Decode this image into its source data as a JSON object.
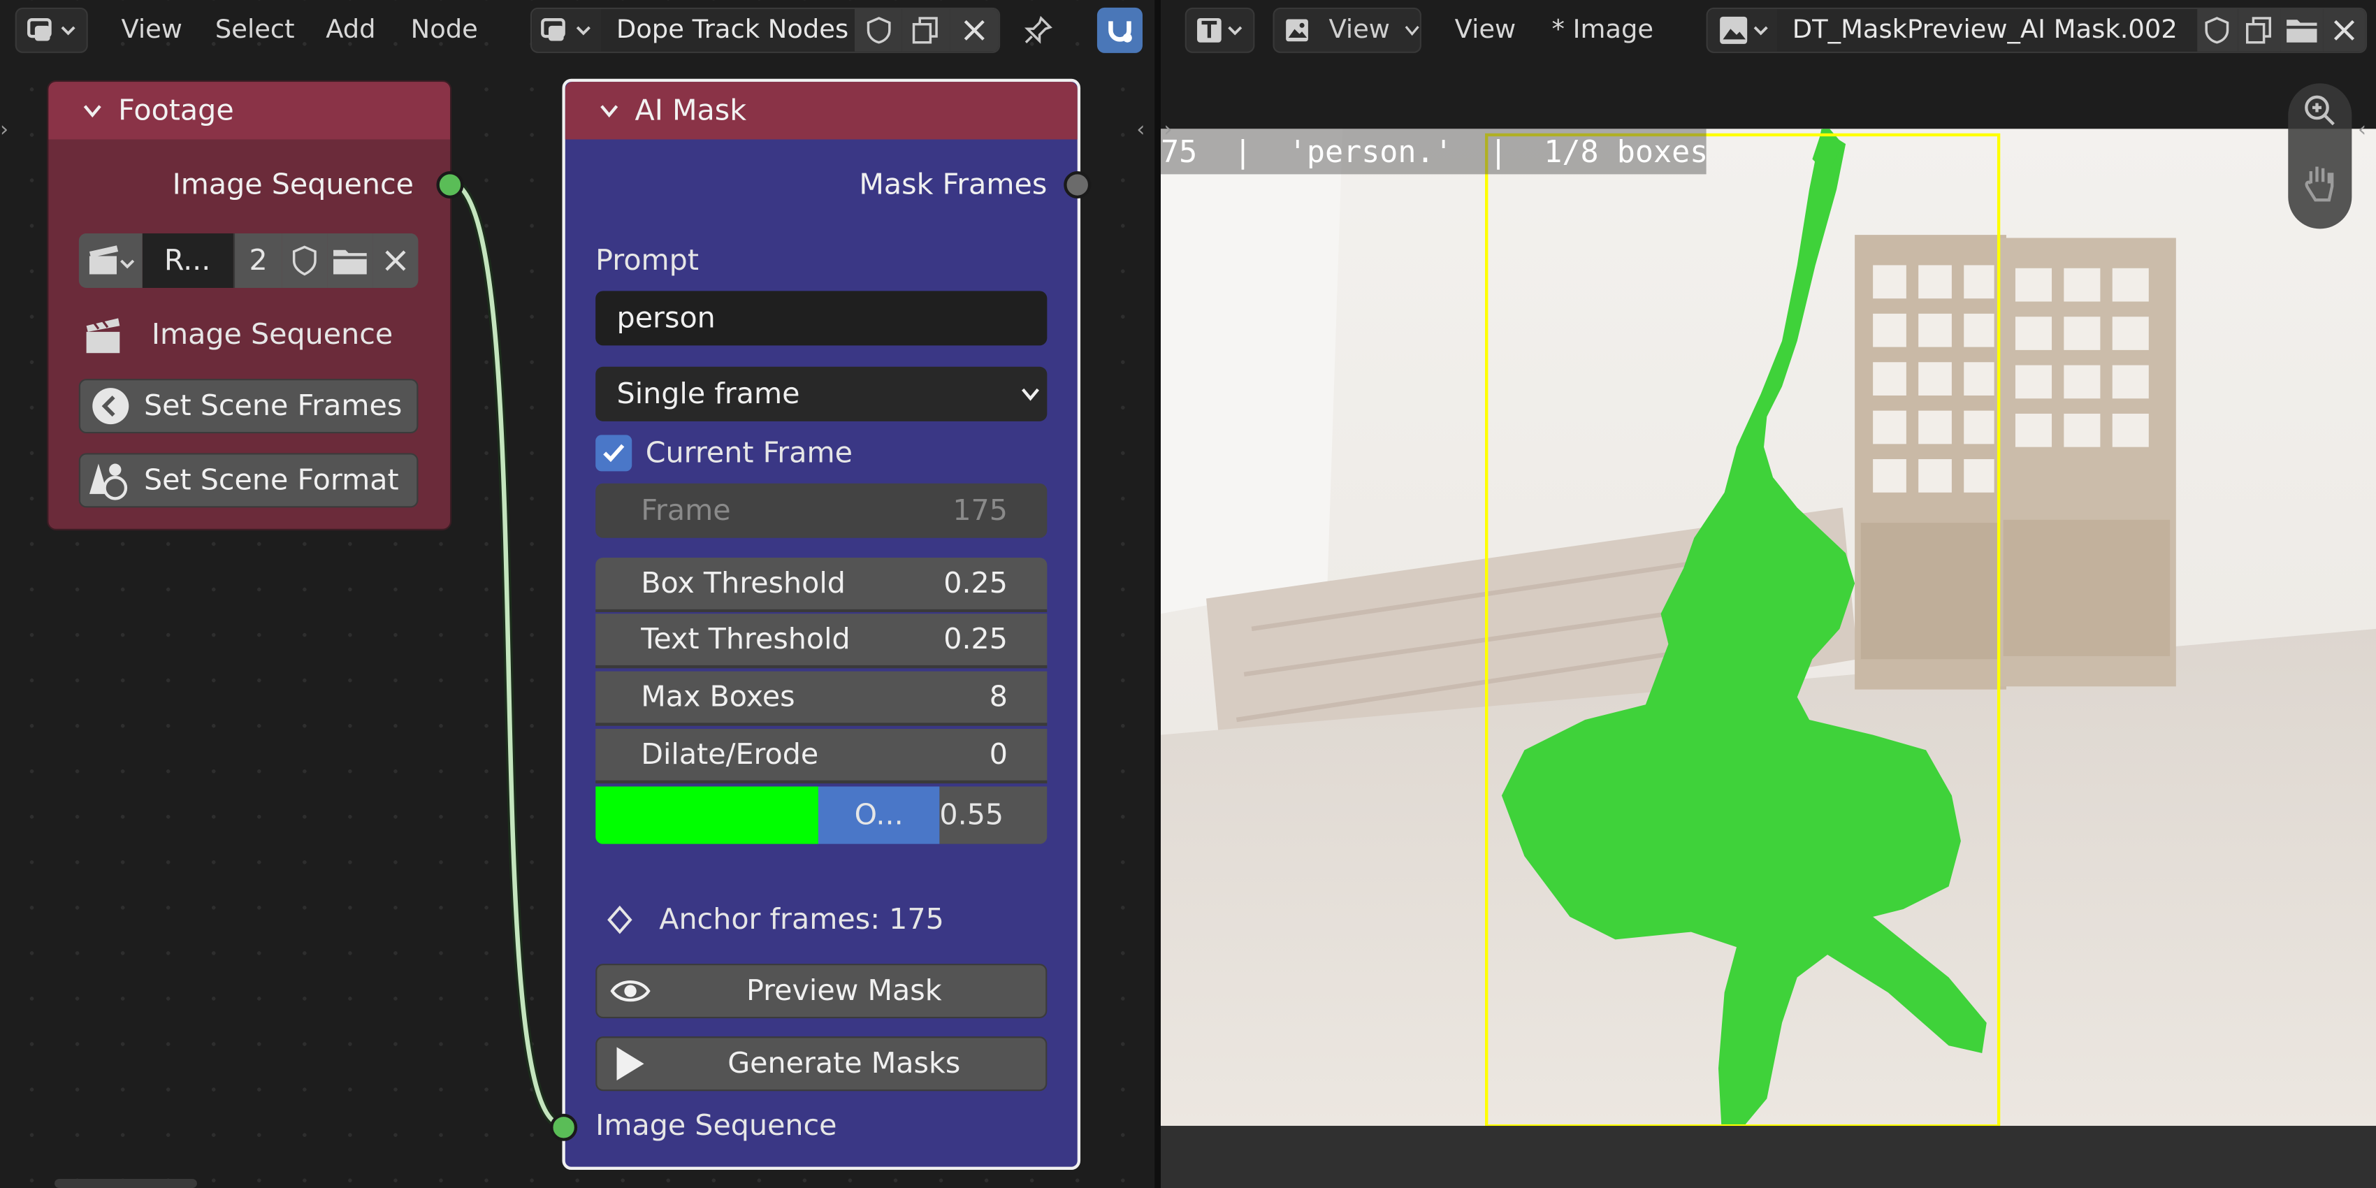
{
  "node_editor": {
    "header": {
      "menus": [
        "View",
        "Select",
        "Add",
        "Node"
      ],
      "node_tree_name": "Dope Track Nodes"
    },
    "footage_node": {
      "title": "Footage",
      "output_label": "Image Sequence",
      "clip_name": "R...",
      "user_count": "2",
      "sequence_label": "Image Sequence",
      "buttons": [
        "Set Scene Frames",
        "Set Scene Format"
      ]
    },
    "ai_mask_node": {
      "title": "AI Mask",
      "output_label": "Mask Frames",
      "prompt_label": "Prompt",
      "prompt_value": "person",
      "mode_value": "Single frame",
      "current_frame_label": "Current Frame",
      "current_frame_checked": true,
      "frame": {
        "label": "Frame",
        "value": "175"
      },
      "params": [
        {
          "label": "Box Threshold",
          "value": "0.25"
        },
        {
          "label": "Text Threshold",
          "value": "0.25"
        },
        {
          "label": "Max Boxes",
          "value": "8"
        },
        {
          "label": "Dilate/Erode",
          "value": "0"
        }
      ],
      "overlay": {
        "color": "#00ff00",
        "label": "O...",
        "value": "0.55"
      },
      "anchor_frames": "Anchor frames: 175",
      "preview_button": "Preview Mask",
      "generate_button": "Generate Masks",
      "input_label": "Image Sequence"
    }
  },
  "image_editor": {
    "header": {
      "view_menu_1": "View",
      "view_menu_2": "View",
      "image_menu": "* Image",
      "image_name": "DT_MaskPreview_AI Mask.002"
    },
    "overlay_text": "75  |  'person.'  |  1/8 boxes",
    "bounding_box_color": "#ffff00",
    "mask_color": "#3fd23a"
  }
}
